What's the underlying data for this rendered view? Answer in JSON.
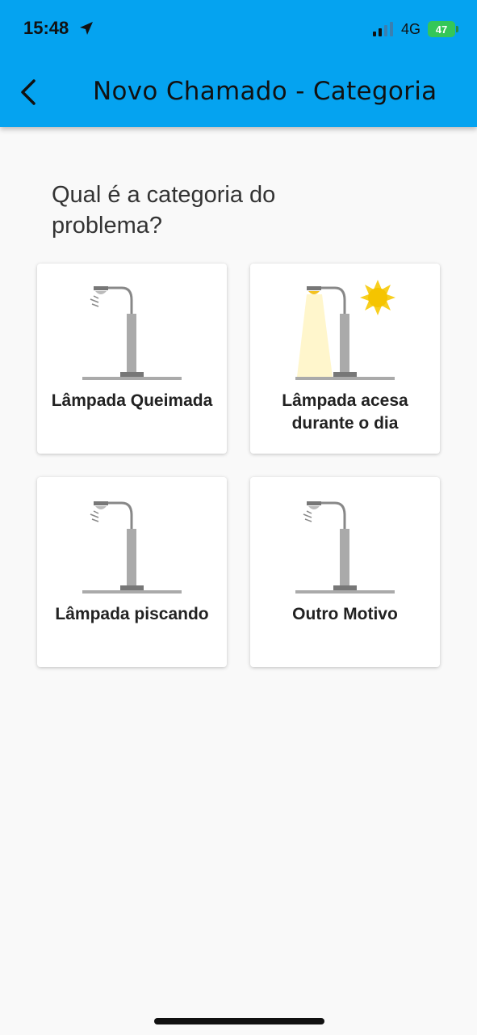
{
  "status_bar": {
    "time": "15:48",
    "network": "4G",
    "battery": "47"
  },
  "header": {
    "title": "Novo Chamado - Categoria",
    "background": "#05a3f0",
    "back_icon": "chevron-left-icon"
  },
  "main": {
    "question": "Qual é a categoria do problema?",
    "categories": [
      {
        "label": "Lâmpada Queimada",
        "icon": "streetlight-icon"
      },
      {
        "label": "Lâmpada acesa durante o dia",
        "icon": "streetlight-sun-icon"
      },
      {
        "label": "Lâmpada piscando",
        "icon": "streetlight-icon"
      },
      {
        "label": "Outro Motivo",
        "icon": "streetlight-icon"
      }
    ]
  }
}
